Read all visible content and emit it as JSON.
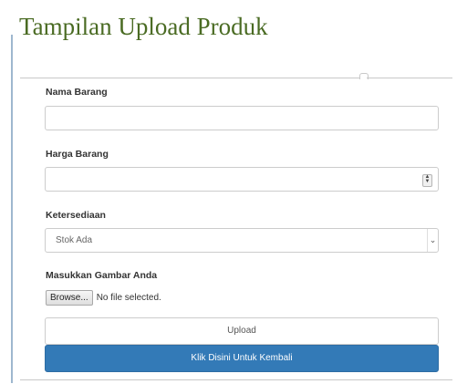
{
  "page": {
    "title": "Tampilan Upload Produk"
  },
  "form": {
    "nama_barang": {
      "label": "Nama Barang",
      "value": ""
    },
    "harga_barang": {
      "label": "Harga Barang",
      "value": ""
    },
    "ketersediaan": {
      "label": "Ketersediaan",
      "selected": "Stok Ada"
    },
    "gambar": {
      "label": "Masukkan Gambar Anda",
      "browse_label": "Browse...",
      "status": "No file selected."
    },
    "upload_label": "Upload",
    "back_label": "Klik Disini Untuk Kembali"
  },
  "icons": {
    "spinner": "number-spinner-icon",
    "select_arrow": "chevron-down-icon"
  },
  "colors": {
    "title": "#4a6b23",
    "primary_button": "#337ab7"
  }
}
